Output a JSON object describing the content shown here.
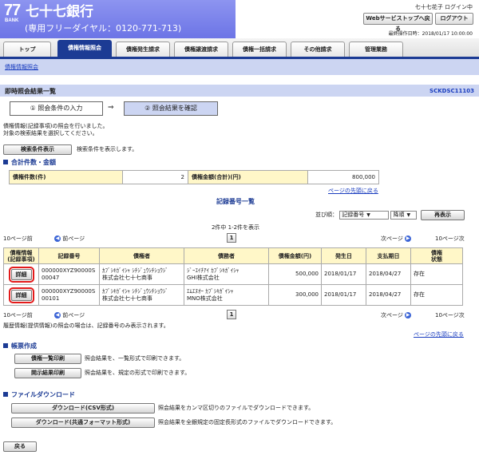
{
  "header": {
    "logo_mark": "77",
    "logo_sub": "BANK",
    "bank_name": "七十七銀行",
    "dial": "(専用フリーダイヤル：0120-771-713)",
    "user_status": "七十七花子 ログイン中",
    "portal_button": "Webサービストップへ戻る",
    "logout_button": "ログアウト",
    "last_login": "最終操作日時：2018/01/17 10:00:00"
  },
  "tabs": [
    {
      "label": "トップ"
    },
    {
      "label": "債権情報照会"
    },
    {
      "label": "債権発生請求"
    },
    {
      "label": "債権譲渡請求"
    },
    {
      "label": "債権一括請求"
    },
    {
      "label": "その他請求"
    },
    {
      "label": "管理業務"
    }
  ],
  "subnav": {
    "link": "債権情報照会"
  },
  "page": {
    "title": "即時照会結果一覧",
    "screen_code": "SCKDSC11103"
  },
  "steps": {
    "step1": "① 照会条件の入力",
    "arrow": "⇒",
    "step2": "② 照会結果を確認"
  },
  "intro": {
    "line1": "債権情報(記録事項)の照会を行いました。",
    "line2": "対象の検索結果を選択してください。"
  },
  "search_toggle": {
    "button": "検索条件表示",
    "note": "検索条件を表示します。"
  },
  "totals": {
    "section": "合計件数・金額",
    "count_label": "債権件数(件)",
    "count_value": "2",
    "amount_label": "債権金額(合計)(円)",
    "amount_value": "800,000",
    "page_top": "ページの先頭に戻る"
  },
  "records": {
    "title": "記録番号一覧",
    "sort_label": "並び順：",
    "sort_key": "記録番号",
    "sort_order": "降順",
    "redisplay": "再表示",
    "count": "2件中 1-2件を表示",
    "prev10": "10ページ前",
    "prev": "前ページ",
    "page": "1",
    "next": "次ページ",
    "next10": "10ページ次",
    "headers": [
      "債権情報\n(記録事項)",
      "記録番号",
      "債権者",
      "債務者",
      "債権金額(円)",
      "発生日",
      "支払期日",
      "債権\n状態"
    ],
    "rows": [
      {
        "detail": "詳細",
        "record_no": "000000XYZ90000S00047",
        "creditor_kana": "ｶﾌﾞｼｷｶﾞｲｼｬ ｼﾁｼﾞｭｳｼﾁｼｮｳｼﾞ",
        "creditor": "株式会社七十七商事",
        "debtor_kana": "ｼﾞｰｴｲﾁｱｲ ｶﾌﾞｼｷｶﾞｲｼｬ",
        "debtor": "GHI株式会社",
        "amount": "500,000",
        "issue_date": "2018/01/17",
        "due_date": "2018/04/27",
        "status": "存在"
      },
      {
        "detail": "詳細",
        "record_no": "000000XYZ90000S00101",
        "creditor_kana": "ｶﾌﾞｼｷｶﾞｲｼｬ ｼﾁｼﾞｭｳｼﾁｼｮｳｼﾞ",
        "creditor": "株式会社七十七商事",
        "debtor_kana": "ｴﾑｴﾇｵｰ ｶﾌﾞｼｷｶﾞｲｼｬ",
        "debtor": "MNO株式会社",
        "amount": "300,000",
        "issue_date": "2018/01/17",
        "due_date": "2018/04/27",
        "status": "存在"
      }
    ],
    "history_note": "履歴情報(提供情報)の照会の場合は、記録番号のみ表示されます。",
    "page_top": "ページの先頭に戻る"
  },
  "forms": {
    "section": "帳票作成",
    "list_print": "債権一覧印刷",
    "list_print_note": "照会結果を、一覧形式で印刷できます。",
    "disclosure_print": "開示結果印刷",
    "disclosure_print_note": "照会結果を、規定の形式で印刷できます。"
  },
  "download": {
    "section": "ファイルダウンロード",
    "csv": "ダウンロード(CSV形式)",
    "csv_note": "照会結果をカンマ区切りのファイルでダウンロードできます。",
    "common": "ダウンロード(共通フォーマット形式)",
    "common_note": "照会結果を全銀規定の固定長形式のファイルでダウンロードできます。"
  },
  "back_button": "戻る",
  "colors": {
    "navy": "#1c3b94",
    "header_gradient": "#8d94f0",
    "highlight": "#e31b1b",
    "label_bg": "#fff7c8",
    "light_blue": "#ccd5f2"
  }
}
